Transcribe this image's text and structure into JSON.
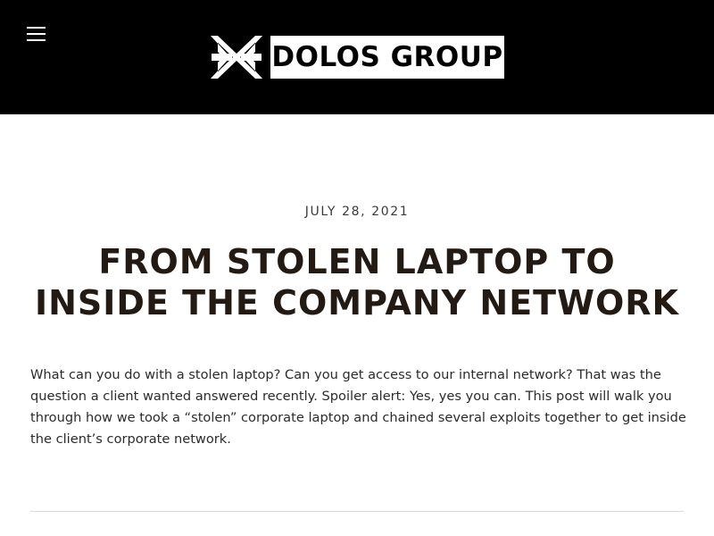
{
  "header": {
    "menu_icon": "hamburger-menu-icon",
    "logo": {
      "text": "DOLOS GROUP",
      "mark_icon": "dolos-logo-mark-icon"
    }
  },
  "post": {
    "date": "JULY 28, 2021",
    "title": "FROM STOLEN LAPTOP TO INSIDE THE COMPANY NETWORK",
    "excerpt": "What can you do with a stolen laptop? Can you get access to our internal network? That was the question a client wanted answered recently. Spoiler alert: Yes, yes you can. This post will walk you through how we took a “stolen” corporate laptop and chained several exploits together to get inside the client’s corporate network."
  },
  "colors": {
    "header_bg": "#000000",
    "title": "#231a14",
    "text": "#2c2c2c"
  }
}
